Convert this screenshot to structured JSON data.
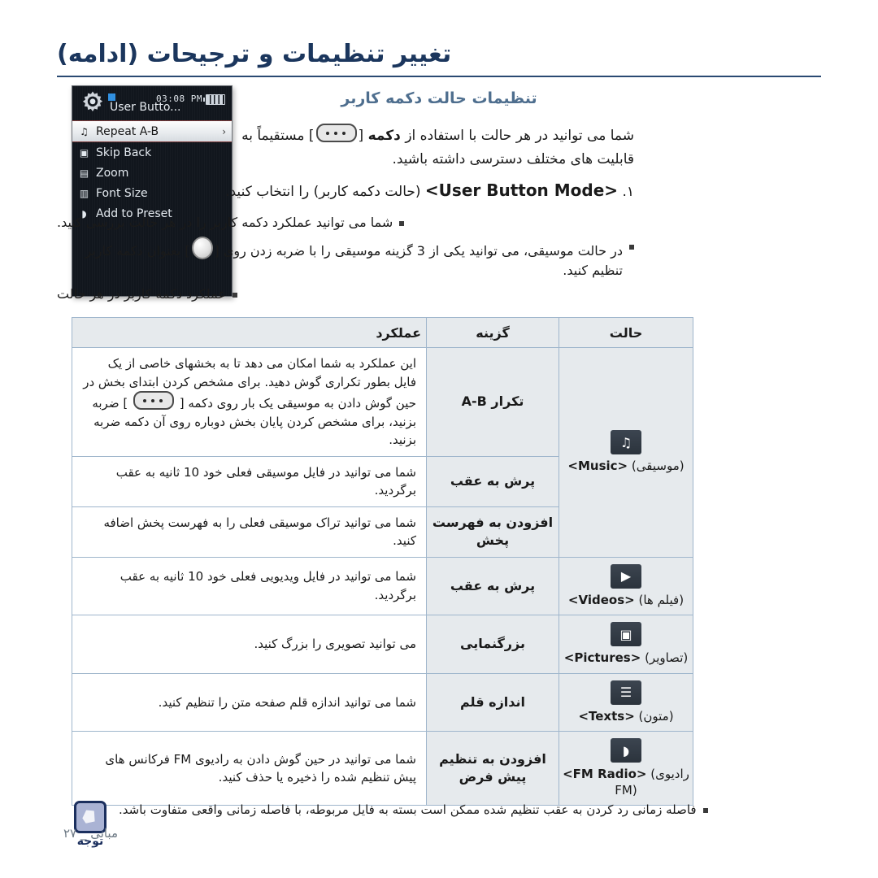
{
  "header": {
    "title": "تغییر تنظیمات و ترجیحات (ادامه)",
    "section_title": "تنظیمات حالت دکمه کاربر"
  },
  "device": {
    "status_time": "03:08 PM",
    "title": "User Butto...",
    "menu_items": [
      {
        "icon": "music-note-icon",
        "glyph": "♫",
        "label": "Repeat A-B",
        "selected": true,
        "chevron": "›"
      },
      {
        "icon": "film-frame-icon",
        "glyph": "▣",
        "label": "Skip Back",
        "selected": false,
        "chevron": ""
      },
      {
        "icon": "picture-icon",
        "glyph": "▤",
        "label": "Zoom",
        "selected": false,
        "chevron": ""
      },
      {
        "icon": "text-doc-icon",
        "glyph": "▥",
        "label": "Font Size",
        "selected": false,
        "chevron": ""
      },
      {
        "icon": "fm-radio-icon",
        "glyph": "◗",
        "label": "Add to Preset",
        "selected": false,
        "chevron": ""
      }
    ]
  },
  "intro": {
    "line1_a": "شما می توانید در هر حالت با استفاده از",
    "line1_b": "دکمه",
    "line1_c": "مستقیماً به",
    "line2": "قابلیت های مختلف دسترسی داشته باشید.",
    "step_number": "۱.",
    "step_en": "<User Button Mode>",
    "step_fa": "(حالت دکمه کاربر) را انتخاب کنید."
  },
  "bullets": [
    {
      "text": "شما می توانید عملکرد دکمه کاربر را در هر حالت بررسی کنید.",
      "has_key": false
    },
    {
      "text_a": "در حالت موسیقی، می توانید یکی از 3 گزینه موسیقی را با ضربه زدن روی",
      "text_b": "بعنوان دکمه کاربر تنظیم کنید.",
      "has_key": true
    },
    {
      "text": "عملکرد دکمه کاربر در هر حالت",
      "has_key": false
    }
  ],
  "table": {
    "headers": {
      "mode": "حالت",
      "option": "گزینه",
      "function": "عملکرد"
    },
    "rows": [
      {
        "mode_en": "<Music>",
        "mode_fa": "(موسیقی)",
        "mode_icon": "music-note-icon",
        "mode_glyph": "♫",
        "mode_rowspan": 3,
        "option": "تکرار A-B",
        "function": "این عملکرد به شما امکان می دهد تا به بخشهای خاصی از یک فایل بطور تکراری گوش دهید. برای مشخص کردن ابتدای بخش در حین گوش دادن به موسیقی یک بار روی دکمه [",
        "function_tail": "] ضربه بزنید، برای مشخص کردن پایان بخش دوباره روی آن دکمه ضربه بزنید.",
        "function_has_key": true
      },
      {
        "option": "پرش به عقب",
        "function": "شما می توانید در فایل موسیقی فعلی خود 10 ثانیه به عقب برگردید.",
        "function_has_key": false
      },
      {
        "option": "افزودن به فهرست پخش",
        "function": "شما می توانید تراک موسیقی فعلی را به فهرست پخش اضافه کنید.",
        "function_has_key": false
      },
      {
        "mode_en": "<Videos>",
        "mode_fa": "(فیلم ها)",
        "mode_icon": "film-frame-icon",
        "mode_glyph": "▶",
        "mode_rowspan": 1,
        "option": "پرش به عقب",
        "function": "شما می توانید در فایل ویدیویی فعلی خود 10 ثانیه به عقب برگردید.",
        "function_has_key": false
      },
      {
        "mode_en": "<Pictures>",
        "mode_fa": "(تصاویر)",
        "mode_icon": "picture-icon",
        "mode_glyph": "▣",
        "mode_rowspan": 1,
        "option": "بزرگنمایی",
        "function": "می توانید تصویری را بزرگ کنید.",
        "function_has_key": false
      },
      {
        "mode_en": "<Texts>",
        "mode_fa": "(متون)",
        "mode_icon": "text-doc-icon",
        "mode_glyph": "☰",
        "mode_rowspan": 1,
        "option": "اندازه قلم",
        "function": "شما می توانید اندازه قلم صفحه متن را تنظیم کنید.",
        "function_has_key": false
      },
      {
        "mode_en": "<FM Radio>",
        "mode_fa": "(رادیوی FM)",
        "mode_icon": "fm-radio-icon",
        "mode_glyph": "◗",
        "mode_rowspan": 1,
        "option": "افزودن به تنظیم پیش فرض",
        "function": "شما می توانید در حین گوش دادن به رادیوی FM فرکانس های پیش تنظیم شده را ذخیره یا حذف کنید.",
        "function_has_key": false
      }
    ]
  },
  "note": {
    "label": "توجه",
    "icon": "note-hand-icon",
    "text": "فاصله زمانی رد کردن به عقب تنظیم شده ممکن است بسته به فایل مربوطه، با فاصله زمانی واقعی متفاوت باشد."
  },
  "footer": {
    "page_label": "مبانی",
    "separator": "_",
    "page_number": "۲۷"
  },
  "colors": {
    "title_navy": "#1b365d",
    "section_blue": "#4e6e8e",
    "table_border": "#9fb6cc",
    "cell_gray": "#e6eaed",
    "icon_dark": "#2b333c"
  }
}
